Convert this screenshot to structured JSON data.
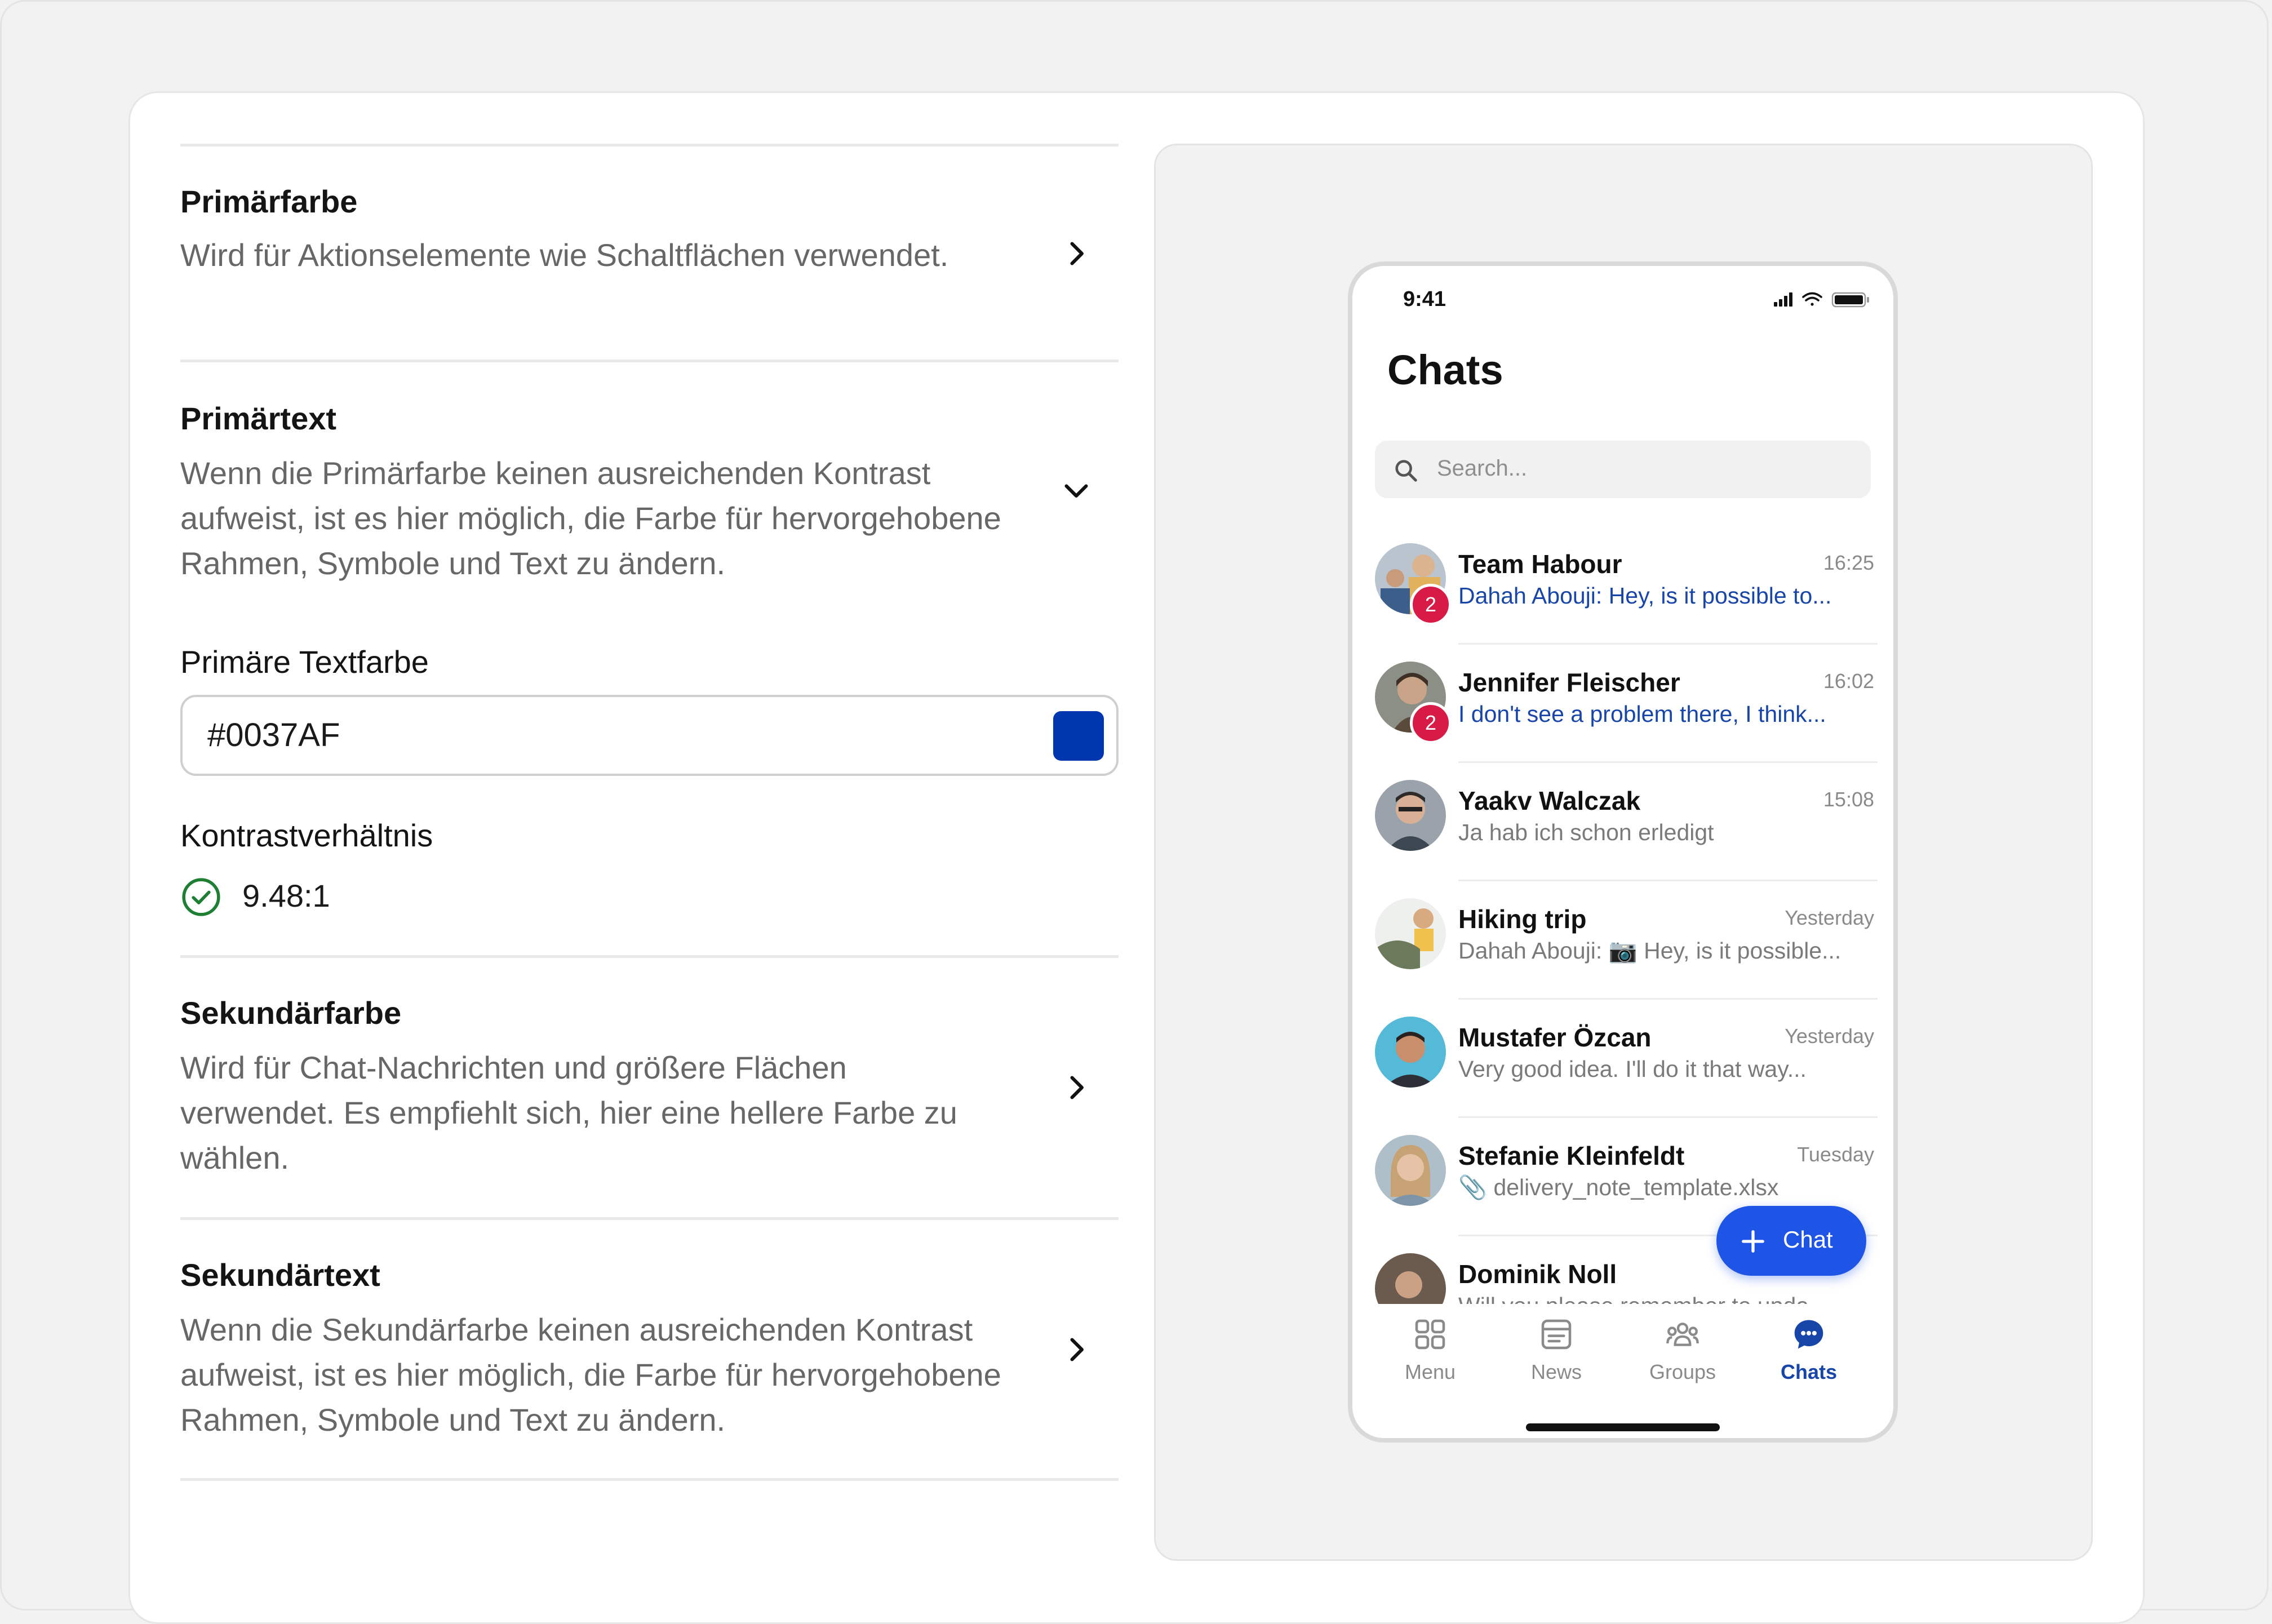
{
  "settings": {
    "primary_color": {
      "title": "Primärfarbe",
      "description": "Wird für Aktionselemente wie Schaltflächen verwendet."
    },
    "primary_text": {
      "title": "Primärtext",
      "description": "Wenn die Primärfarbe keinen ausreichenden Kontrast aufweist, ist es hier möglich, die Farbe für hervorgehobene Rahmen, Symbole und Text zu ändern.",
      "text_color_label": "Primäre Textfarbe",
      "text_color_value": "#0037AF",
      "contrast_label": "Kontrastverhältnis",
      "contrast_value": "9.48:1"
    },
    "secondary_color": {
      "title": "Sekundärfarbe",
      "description": "Wird für Chat-Nachrichten und größere Flächen verwendet. Es empfiehlt sich, hier eine hellere Farbe zu wählen."
    },
    "secondary_text": {
      "title": "Sekundärtext",
      "description": "Wenn die Sekundärfarbe keinen ausreichenden Kontrast aufweist, ist es hier möglich, die Farbe für hervorgehobene Rahmen, Symbole und Text zu ändern."
    }
  },
  "phone": {
    "status_time": "9:41",
    "title": "Chats",
    "search_placeholder": "Search...",
    "chats": [
      {
        "name": "Team Habour",
        "time": "16:25",
        "preview": "Dahah Abouji: Hey, is it possible to...",
        "badge": "2",
        "unread": true
      },
      {
        "name": "Jennifer Fleischer",
        "time": "16:02",
        "preview": "I don't see a problem there, I think...",
        "badge": "2",
        "unread": true
      },
      {
        "name": "Yaakv Walczak",
        "time": "15:08",
        "preview": "Ja hab ich schon erledigt",
        "badge": "",
        "unread": false
      },
      {
        "name": "Hiking trip",
        "time": "Yesterday",
        "preview": "Dahah Abouji: 📷 Hey, is it possible...",
        "badge": "",
        "unread": false
      },
      {
        "name": "Mustafer Özcan",
        "time": "Yesterday",
        "preview": "Very good idea. I'll do it that way...",
        "badge": "",
        "unread": false
      },
      {
        "name": "Stefanie Kleinfeldt",
        "time": "Tuesday",
        "preview": "📎 delivery_note_template.xlsx",
        "badge": "",
        "unread": false
      },
      {
        "name": "Dominik Noll",
        "time": "",
        "preview": "Will you please remember to upda...",
        "badge": "",
        "unread": false
      }
    ],
    "fab_label": "Chat",
    "tabs": [
      {
        "label": "Menu",
        "icon": "grid-icon",
        "active": false
      },
      {
        "label": "News",
        "icon": "news-icon",
        "active": false
      },
      {
        "label": "Groups",
        "icon": "groups-icon",
        "active": false
      },
      {
        "label": "Chats",
        "icon": "chat-bubble-icon",
        "active": true
      }
    ]
  },
  "colors": {
    "primary_text": "#0037AF",
    "accent": "#1F55E6",
    "badge": "#D81B46",
    "success": "#1E7E34"
  }
}
